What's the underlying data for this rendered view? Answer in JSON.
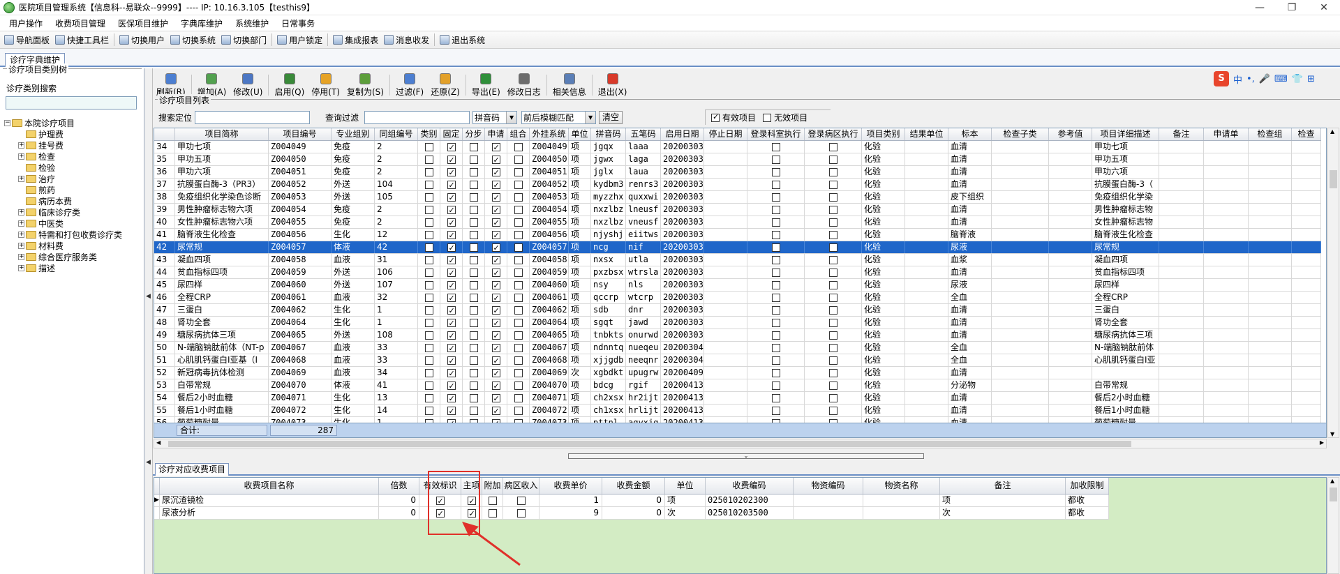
{
  "window": {
    "title": "医院项目管理系统【信息科--易联众--9999】---- IP: 10.16.3.105【testhis9】",
    "controls": [
      "—",
      "❐",
      "✕"
    ]
  },
  "menu": [
    "用户操作",
    "收费项目管理",
    "医保项目维护",
    "字典库维护",
    "系统维护",
    "日常事务"
  ],
  "toolbar": [
    "导航面板",
    "快捷工具栏",
    "切换用户",
    "切换系统",
    "切换部门",
    "用户锁定",
    "集成报表",
    "消息收发",
    "退出系统"
  ],
  "tab": "诊疗字典维护",
  "left": {
    "group_title": "诊疗项目类别树",
    "search_label": "诊疗类别搜索",
    "search_value": "",
    "tree": [
      {
        "label": "本院诊疗项目",
        "level": 0,
        "exp": "⊟"
      },
      {
        "label": "护理费",
        "level": 1,
        "exp": ""
      },
      {
        "label": "挂号费",
        "level": 1,
        "exp": "⊞"
      },
      {
        "label": "检查",
        "level": 1,
        "exp": "⊞"
      },
      {
        "label": "检验",
        "level": 1,
        "exp": ""
      },
      {
        "label": "治疗",
        "level": 1,
        "exp": "⊞"
      },
      {
        "label": "煎药",
        "level": 1,
        "exp": ""
      },
      {
        "label": "病历本费",
        "level": 1,
        "exp": ""
      },
      {
        "label": "临床诊疗类",
        "level": 1,
        "exp": "⊞"
      },
      {
        "label": "中医类",
        "level": 1,
        "exp": "⊞"
      },
      {
        "label": "特需和打包收费诊疗类",
        "level": 1,
        "exp": "⊞"
      },
      {
        "label": "材料费",
        "level": 1,
        "exp": "⊞"
      },
      {
        "label": "综合医疗服务类",
        "level": 1,
        "exp": "⊞"
      },
      {
        "label": "描述",
        "level": 1,
        "exp": "⊞"
      }
    ]
  },
  "actions": [
    "刷新(R)",
    "增加(A)",
    "修改(U)",
    "启用(Q)",
    "停用(T)",
    "复制为(S)",
    "过滤(F)",
    "还原(Z)",
    "导出(E)",
    "修改日志",
    "相关信息",
    "退出(X)"
  ],
  "ime": [
    "S",
    "中",
    "•,",
    "🎤",
    "⌨",
    "👕",
    "⊞"
  ],
  "list": {
    "group_title": "诊疗项目列表",
    "search_label": "搜索定位",
    "search_value": "",
    "filter_label": "查询过滤",
    "filter_value": "",
    "code_type": "拼音码",
    "match_mode": "前后模糊匹配",
    "clear_label": "清空",
    "valid_label": "有效项目",
    "invalid_label": "无效项目",
    "columns": [
      "",
      "项目简称",
      "项目编号",
      "专业组别",
      "同组编号",
      "类别",
      "固定",
      "分步",
      "申请",
      "组合",
      "外挂系统",
      "单位",
      "拼音码",
      "五笔码",
      "启用日期",
      "停止日期",
      "登录科室执行",
      "登录病区执行",
      "项目类别",
      "结果单位",
      "标本",
      "检查子类",
      "参考值",
      "项目详细描述",
      "备注",
      "申请单",
      "检查组",
      "检查"
    ],
    "rows": [
      [
        "34",
        "甲功七项",
        "Z004049",
        "免疫",
        "2",
        "",
        "✓",
        "",
        "✓",
        "",
        "Z004049",
        "项",
        "jgqx",
        "laaa",
        "20200303",
        "",
        "",
        "",
        "化验",
        "",
        "血清",
        "",
        "",
        "甲功七项",
        "",
        "",
        "",
        ""
      ],
      [
        "35",
        "甲功五项",
        "Z004050",
        "免疫",
        "2",
        "",
        "✓",
        "",
        "✓",
        "",
        "Z004050",
        "项",
        "jgwx",
        "laga",
        "20200303",
        "",
        "",
        "",
        "化验",
        "",
        "血清",
        "",
        "",
        "甲功五项",
        "",
        "",
        "",
        ""
      ],
      [
        "36",
        "甲功六项",
        "Z004051",
        "免疫",
        "2",
        "",
        "✓",
        "",
        "✓",
        "",
        "Z004051",
        "项",
        "jglx",
        "laua",
        "20200303",
        "",
        "",
        "",
        "化验",
        "",
        "血清",
        "",
        "",
        "甲功六项",
        "",
        "",
        "",
        ""
      ],
      [
        "37",
        "抗膜蛋白酶-3（PR3）",
        "Z004052",
        "外送",
        "104",
        "",
        "✓",
        "",
        "✓",
        "",
        "Z004052",
        "项",
        "kydbm3",
        "renrs3",
        "20200303",
        "",
        "",
        "",
        "化验",
        "",
        "血清",
        "",
        "",
        "抗膜蛋白酶-3（",
        "",
        "",
        "",
        ""
      ],
      [
        "38",
        "免疫组织化学染色诊断",
        "Z004053",
        "外送",
        "105",
        "",
        "✓",
        "",
        "✓",
        "",
        "Z004053",
        "项",
        "myzzhx",
        "quxxwi",
        "20200303",
        "",
        "",
        "",
        "化验",
        "",
        "皮下组织",
        "",
        "",
        "免疫组织化学染",
        "",
        "",
        "",
        ""
      ],
      [
        "39",
        "男性肿瘤标志物六项",
        "Z004054",
        "免疫",
        "2",
        "",
        "✓",
        "",
        "✓",
        "",
        "Z004054",
        "项",
        "nxzlbz",
        "lneusf",
        "20200303",
        "",
        "",
        "",
        "化验",
        "",
        "血清",
        "",
        "",
        "男性肿瘤标志物",
        "",
        "",
        "",
        ""
      ],
      [
        "40",
        "女性肿瘤标志物六项",
        "Z004055",
        "免疫",
        "2",
        "",
        "✓",
        "",
        "✓",
        "",
        "Z004055",
        "项",
        "nxzlbz",
        "vneusf",
        "20200303",
        "",
        "",
        "",
        "化验",
        "",
        "血清",
        "",
        "",
        "女性肿瘤标志物",
        "",
        "",
        "",
        ""
      ],
      [
        "41",
        "脑脊液生化检查",
        "Z004056",
        "生化",
        "12",
        "",
        "✓",
        "",
        "✓",
        "",
        "Z004056",
        "项",
        "njyshj",
        "eiitws",
        "20200303",
        "",
        "",
        "",
        "化验",
        "",
        "脑脊液",
        "",
        "",
        "脑脊液生化检查",
        "",
        "",
        "",
        ""
      ],
      [
        "42",
        "尿常规",
        "Z004057",
        "体液",
        "42",
        "",
        "✓",
        "",
        "✓",
        "",
        "Z004057",
        "项",
        "ncg",
        "nif",
        "20200303",
        "",
        "",
        "",
        "化验",
        "",
        "尿液",
        "",
        "",
        "尿常规",
        "",
        "",
        "",
        ""
      ],
      [
        "43",
        "凝血四项",
        "Z004058",
        "血液",
        "31",
        "",
        "✓",
        "",
        "✓",
        "",
        "Z004058",
        "项",
        "nxsx",
        "utla",
        "20200303",
        "",
        "",
        "",
        "化验",
        "",
        "血浆",
        "",
        "",
        "凝血四项",
        "",
        "",
        "",
        ""
      ],
      [
        "44",
        "贫血指标四项",
        "Z004059",
        "外送",
        "106",
        "",
        "✓",
        "",
        "✓",
        "",
        "Z004059",
        "项",
        "pxzbsx",
        "wtrsla",
        "20200303",
        "",
        "",
        "",
        "化验",
        "",
        "血清",
        "",
        "",
        "贫血指标四项",
        "",
        "",
        "",
        ""
      ],
      [
        "45",
        "尿四样",
        "Z004060",
        "外送",
        "107",
        "",
        "✓",
        "",
        "✓",
        "",
        "Z004060",
        "项",
        "nsy",
        "nls",
        "20200303",
        "",
        "",
        "",
        "化验",
        "",
        "尿液",
        "",
        "",
        "尿四样",
        "",
        "",
        "",
        ""
      ],
      [
        "46",
        "全程CRP",
        "Z004061",
        "血液",
        "32",
        "",
        "✓",
        "",
        "✓",
        "",
        "Z004061",
        "项",
        "qccrp",
        "wtcrp",
        "20200303",
        "",
        "",
        "",
        "化验",
        "",
        "全血",
        "",
        "",
        "全程CRP",
        "",
        "",
        "",
        ""
      ],
      [
        "47",
        "三蛋白",
        "Z004062",
        "生化",
        "1",
        "",
        "✓",
        "",
        "✓",
        "",
        "Z004062",
        "项",
        "sdb",
        "dnr",
        "20200303",
        "",
        "",
        "",
        "化验",
        "",
        "血清",
        "",
        "",
        "三蛋白",
        "",
        "",
        "",
        ""
      ],
      [
        "48",
        "肾功全套",
        "Z004064",
        "生化",
        "1",
        "",
        "✓",
        "",
        "✓",
        "",
        "Z004064",
        "项",
        "sgqt",
        "jawd",
        "20200303",
        "",
        "",
        "",
        "化验",
        "",
        "血清",
        "",
        "",
        "肾功全套",
        "",
        "",
        "",
        ""
      ],
      [
        "49",
        "糖尿病抗体三项",
        "Z004065",
        "外送",
        "108",
        "",
        "✓",
        "",
        "✓",
        "",
        "Z004065",
        "项",
        "tnbkts",
        "onurwd",
        "20200303",
        "",
        "",
        "",
        "化验",
        "",
        "血清",
        "",
        "",
        "糖尿病抗体三项",
        "",
        "",
        "",
        ""
      ],
      [
        "50",
        "N-端脑钠肽前体（NT-p",
        "Z004067",
        "血液",
        "33",
        "",
        "✓",
        "",
        "✓",
        "",
        "Z004067",
        "项",
        "ndnntq",
        "nueqeu",
        "20200304",
        "",
        "",
        "",
        "化验",
        "",
        "全血",
        "",
        "",
        "N-端脑钠肽前体",
        "",
        "",
        "",
        ""
      ],
      [
        "51",
        "心肌肌钙蛋白I亚基（I",
        "Z004068",
        "血液",
        "33",
        "",
        "✓",
        "",
        "✓",
        "",
        "Z004068",
        "项",
        "xjjgdb",
        "neeqnr",
        "20200304",
        "",
        "",
        "",
        "化验",
        "",
        "全血",
        "",
        "",
        "心肌肌钙蛋白I亚",
        "",
        "",
        "",
        ""
      ],
      [
        "52",
        "新冠病毒抗体检测",
        "Z004069",
        "血液",
        "34",
        "",
        "✓",
        "",
        "✓",
        "",
        "Z004069",
        "次",
        "xgbdkt",
        "upugrw",
        "20200409",
        "",
        "",
        "",
        "化验",
        "",
        "血清",
        "",
        "",
        "",
        "",
        "",
        "",
        ""
      ],
      [
        "53",
        "白带常规",
        "Z004070",
        "体液",
        "41",
        "",
        "✓",
        "",
        "✓",
        "",
        "Z004070",
        "项",
        "bdcg",
        "rgif",
        "20200413",
        "",
        "",
        "",
        "化验",
        "",
        "分泌物",
        "",
        "",
        "白带常规",
        "",
        "",
        "",
        ""
      ],
      [
        "54",
        "餐后2小时血糖",
        "Z004071",
        "生化",
        "13",
        "",
        "✓",
        "",
        "✓",
        "",
        "Z004071",
        "项",
        "ch2xsx",
        "hr2ijt",
        "20200413",
        "",
        "",
        "",
        "化验",
        "",
        "血清",
        "",
        "",
        "餐后2小时血糖",
        "",
        "",
        "",
        ""
      ],
      [
        "55",
        "餐后1小时血糖",
        "Z004072",
        "生化",
        "14",
        "",
        "✓",
        "",
        "✓",
        "",
        "Z004072",
        "项",
        "ch1xsx",
        "hrlijt",
        "20200413",
        "",
        "",
        "",
        "化验",
        "",
        "血清",
        "",
        "",
        "餐后1小时血糖",
        "",
        "",
        "",
        ""
      ],
      [
        "56",
        "葡萄糖耐量",
        "Z004073",
        "生化",
        "1",
        "",
        "✓",
        "",
        "✓",
        "",
        "Z004073",
        "项",
        "pttnl",
        "aqyxjg",
        "20200413",
        "",
        "",
        "",
        "化验",
        "",
        "血清",
        "",
        "",
        "葡萄糖耐量",
        "",
        "",
        "",
        ""
      ]
    ],
    "selected_row": 8,
    "footer_label": "合计:",
    "footer_total": "287"
  },
  "bottom": {
    "tab": "诊疗对应收费项目",
    "columns": [
      "",
      "收费项目名称",
      "倍数",
      "有效标识",
      "主项",
      "附加",
      "病区收入",
      "收费单价",
      "收费金额",
      "单位",
      "收费编码",
      "物资编码",
      "物资名称",
      "备注",
      "加收限制"
    ],
    "rows": [
      [
        "▶",
        "尿沉渣镜检",
        "0",
        "✓",
        "✓",
        "",
        "",
        "1",
        "0",
        "项",
        "025010202300",
        "",
        "",
        "项",
        "都收"
      ],
      [
        "",
        "尿液分析",
        "0",
        "✓",
        "✓",
        "",
        "",
        "9",
        "0",
        "次",
        "025010203500",
        "",
        "",
        "次",
        "都收"
      ]
    ]
  },
  "colors": {
    "selection": "#1f66c9",
    "footer": "#bcd2ee",
    "subgrid_bg": "#d3ecc4",
    "highlight": "#e0302a"
  }
}
